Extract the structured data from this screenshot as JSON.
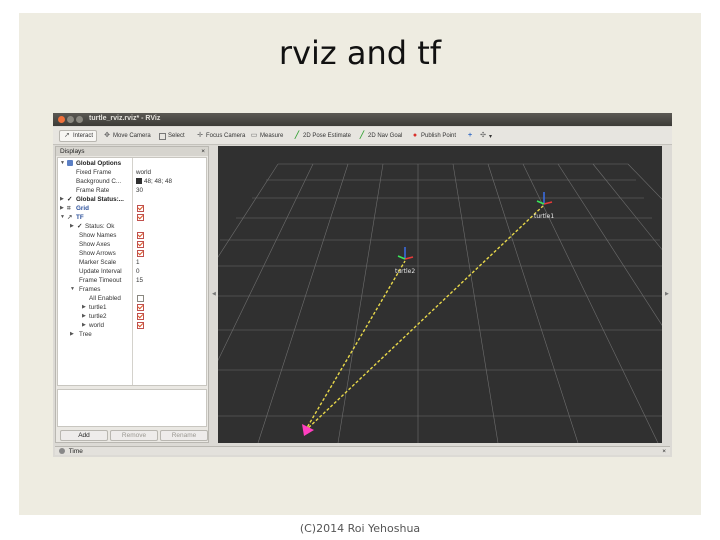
{
  "slide": {
    "title": "rviz and tf",
    "footer": "(C)2014 Roi Yehoshua"
  },
  "window": {
    "title": "turtle_rviz.rviz* - RViz"
  },
  "toolbar": {
    "tools": [
      {
        "label": "Interact",
        "icon": "interact-icon",
        "active": true
      },
      {
        "label": "Move Camera",
        "icon": "move-camera-icon"
      },
      {
        "label": "Select",
        "icon": "select-icon"
      },
      {
        "label": "Focus Camera",
        "icon": "focus-camera-icon"
      },
      {
        "label": "Measure",
        "icon": "measure-icon"
      },
      {
        "label": "2D Pose Estimate",
        "icon": "pose-estimate-icon"
      },
      {
        "label": "2D Nav Goal",
        "icon": "nav-goal-icon"
      },
      {
        "label": "Publish Point",
        "icon": "publish-point-icon"
      }
    ],
    "plus_symbol": "+",
    "dropdown_symbol": "▾"
  },
  "displays": {
    "header": "Displays",
    "close_symbol": "×",
    "global_options_label": "Global Options",
    "fixed_frame_label": "Fixed Frame",
    "fixed_frame_value": "world",
    "background_label": "Background C...",
    "background_value": "48; 48; 48",
    "background_color": "#303030",
    "frame_rate_label": "Frame Rate",
    "frame_rate_value": "30",
    "global_status_label": "Global Status:...",
    "grid_label": "Grid",
    "tf_label": "TF",
    "status_label": "Status: Ok",
    "show_names_label": "Show Names",
    "show_axes_label": "Show Axes",
    "show_arrows_label": "Show Arrows",
    "marker_scale_label": "Marker Scale",
    "marker_scale_value": "1",
    "update_interval_label": "Update Interval",
    "update_interval_value": "0",
    "frame_timeout_label": "Frame Timeout",
    "frame_timeout_value": "15",
    "frames_label": "Frames",
    "all_enabled_label": "All Enabled",
    "turtle1_label": "turtle1",
    "turtle2_label": "turtle2",
    "world_label": "world",
    "tree_label": "Tree",
    "add_label": "Add",
    "remove_label": "Remove",
    "rename_label": "Rename"
  },
  "viewport": {
    "frames": [
      {
        "name": "turtle1"
      },
      {
        "name": "turtle2"
      }
    ],
    "link_color": "#e8d84a",
    "origin_color": "#ff3fbf"
  },
  "time_panel": {
    "label": "Time",
    "close_symbol": "×"
  }
}
